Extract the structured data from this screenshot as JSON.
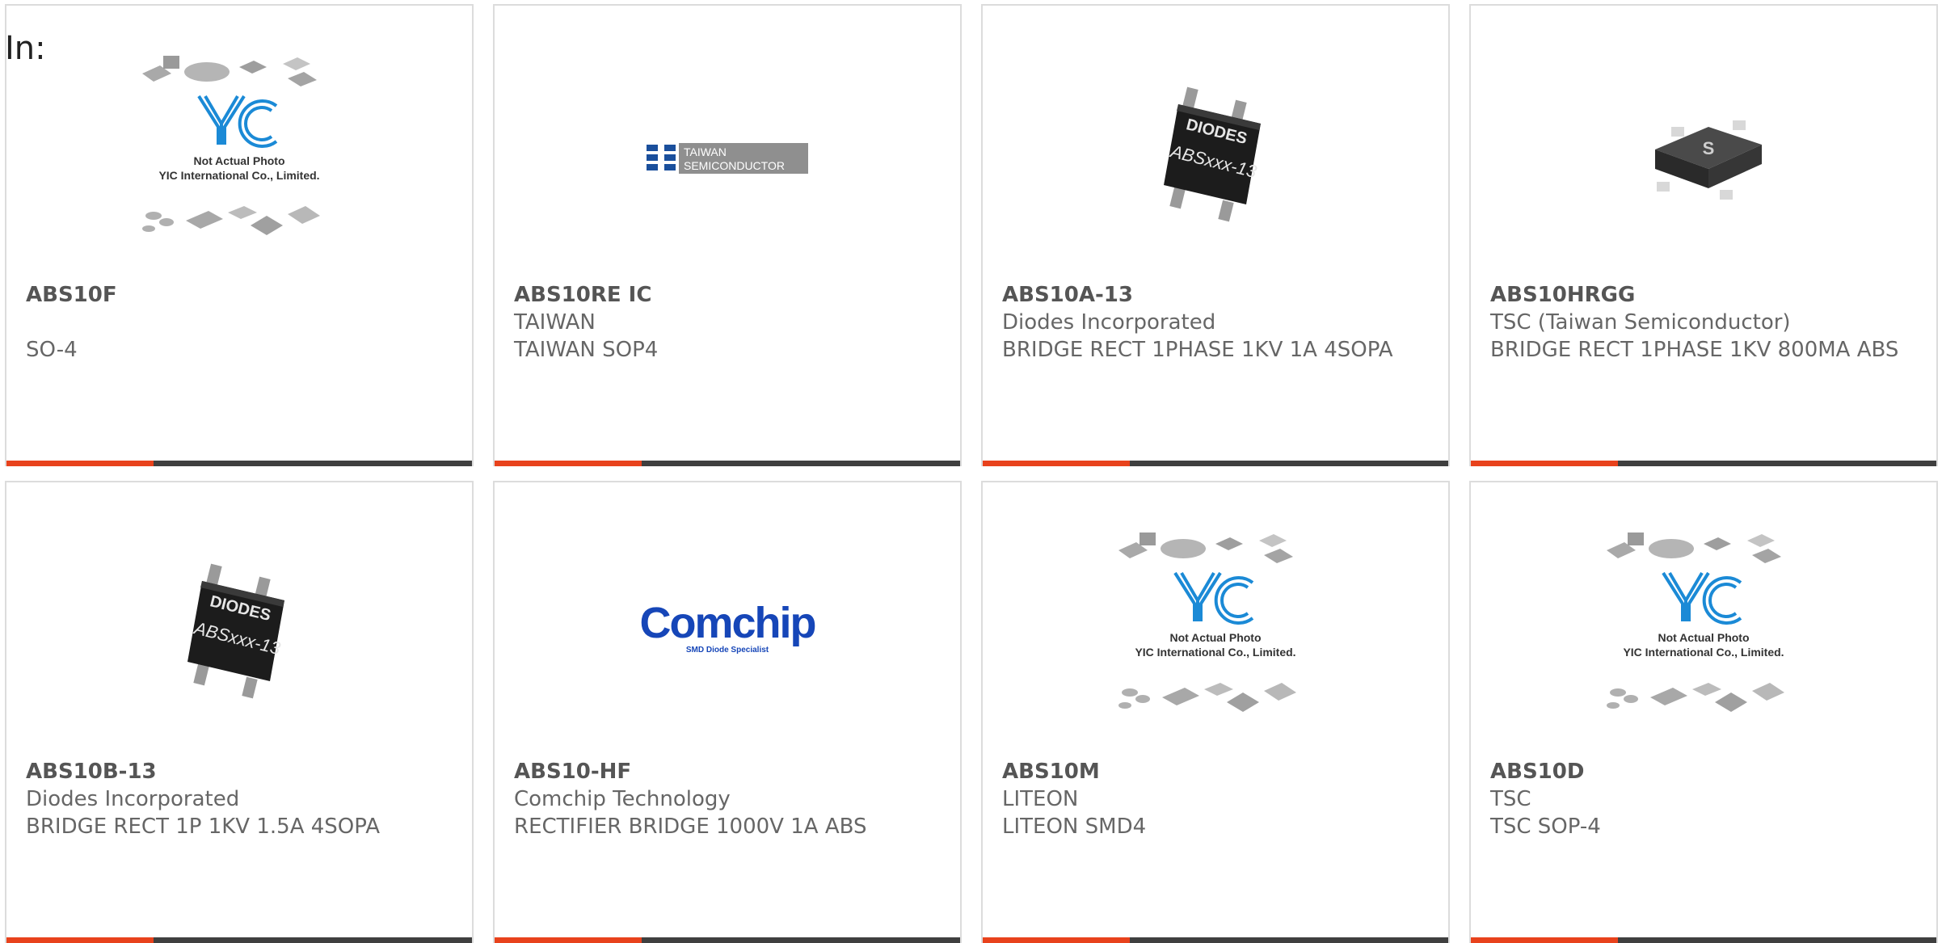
{
  "header": {
    "in_label": "In:"
  },
  "colors": {
    "accent": "#e8421c",
    "bar_dark": "#3f3f3f",
    "border": "#dcdcdc"
  },
  "placeholder": {
    "brand": "YIC",
    "line1": "Not Actual Photo",
    "line2": "YIC International Co., Limited."
  },
  "logos": {
    "taiwan_line1": "TAIWAN",
    "taiwan_line2": "SEMICONDUCTOR",
    "diodes_brand": "DIODES",
    "diodes_marking": "ABSxxx-13",
    "comchip_brand": "Comchip",
    "comchip_tagline": "SMD Diode Specialist"
  },
  "products": [
    {
      "part_number": "ABS10F",
      "manufacturer": "",
      "description": "SO-4",
      "image": "yic-placeholder-image"
    },
    {
      "part_number": "ABS10RE IC",
      "manufacturer": "TAIWAN",
      "description": "TAIWAN SOP4",
      "image": "taiwan-semiconductor-logo"
    },
    {
      "part_number": "ABS10A-13",
      "manufacturer": "Diodes Incorporated",
      "description": "BRIDGE RECT 1PHASE 1KV 1A 4SOPA",
      "image": "diodes-chip-image"
    },
    {
      "part_number": "ABS10HRGG",
      "manufacturer": "TSC (Taiwan Semiconductor)",
      "description": "BRIDGE RECT 1PHASE 1KV 800MA ABS",
      "image": "tsc-chip-image"
    },
    {
      "part_number": "ABS10B-13",
      "manufacturer": "Diodes Incorporated",
      "description": "BRIDGE RECT 1P 1KV 1.5A 4SOPA",
      "image": "diodes-chip-image"
    },
    {
      "part_number": "ABS10-HF",
      "manufacturer": "Comchip Technology",
      "description": "RECTIFIER BRIDGE 1000V 1A ABS",
      "image": "comchip-logo"
    },
    {
      "part_number": "ABS10M",
      "manufacturer": "LITEON",
      "description": "LITEON SMD4",
      "image": "yic-placeholder-image"
    },
    {
      "part_number": "ABS10D",
      "manufacturer": "TSC",
      "description": "TSC SOP-4",
      "image": "yic-placeholder-image"
    }
  ]
}
